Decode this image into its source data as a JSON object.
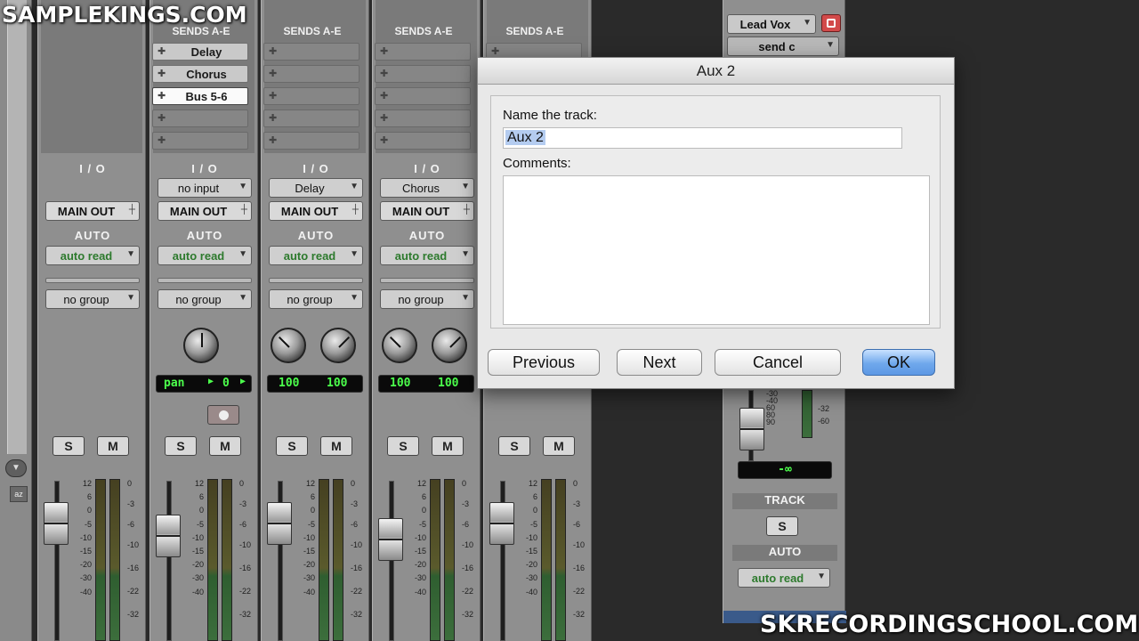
{
  "watermarks": {
    "top_left": "SAMPLEKINGS.COM",
    "bottom_right": "SKRECORDINGSCHOOL.COM"
  },
  "strips": [
    {
      "sends_title": "",
      "sends": [],
      "io_title": "I / O",
      "input": null,
      "output": "MAIN OUT",
      "auto_title": "AUTO",
      "auto_mode": "auto read",
      "group": "no group",
      "pan_type": "none",
      "lcd": null,
      "has_rec": false
    },
    {
      "sends_title": "SENDS A-E",
      "sends": [
        "Delay",
        "Chorus",
        "Bus 5-6"
      ],
      "io_title": "I / O",
      "input": "no input",
      "output": "MAIN OUT",
      "auto_title": "AUTO",
      "auto_mode": "auto read",
      "group": "no group",
      "pan_type": "mono",
      "lcd": {
        "label": "pan",
        "value": "0"
      },
      "has_rec": true
    },
    {
      "sends_title": "SENDS A-E",
      "sends": [],
      "io_title": "I / O",
      "input": "Delay",
      "output": "MAIN OUT",
      "auto_title": "AUTO",
      "auto_mode": "auto read",
      "group": "no group",
      "pan_type": "stereo",
      "lcd": {
        "left": "100",
        "right": "100"
      },
      "has_rec": false
    },
    {
      "sends_title": "SENDS A-E",
      "sends": [],
      "io_title": "I / O",
      "input": "Chorus",
      "output": "MAIN OUT",
      "auto_title": "AUTO",
      "auto_mode": "auto read",
      "group": "no group",
      "pan_type": "stereo",
      "lcd": {
        "left": "100",
        "right": "100"
      },
      "has_rec": false
    },
    {
      "sends_title": "SENDS A-E",
      "sends": [],
      "io_title": "",
      "input": null,
      "output": null,
      "auto_title": "",
      "auto_mode": null,
      "group": null,
      "pan_type": "none",
      "lcd": null,
      "has_rec": false
    }
  ],
  "solo_label": "S",
  "mute_label": "M",
  "fader_scale": [
    "12",
    "6",
    "0",
    "-5",
    "-10",
    "-15",
    "-20",
    "-30",
    "-40"
  ],
  "meter_scale": [
    "0",
    "-3",
    "-6",
    "-10",
    "-16",
    "-22",
    "-32"
  ],
  "right_strip": {
    "track_name": "Lead Vox",
    "send": "send c",
    "fader_scale": [
      "-30",
      "-40",
      "60",
      "80",
      "90"
    ],
    "meter_scale": [
      "-32",
      "-60"
    ],
    "level": "-∞",
    "track_title": "TRACK",
    "solo": "S",
    "auto_title": "AUTO",
    "auto_mode": "auto read"
  },
  "dialog": {
    "title": "Aux 2",
    "name_label": "Name the track:",
    "name_value": "Aux 2",
    "comments_label": "Comments:",
    "comments_value": "",
    "buttons": {
      "previous": "Previous",
      "next": "Next",
      "cancel": "Cancel",
      "ok": "OK"
    }
  },
  "colors": {
    "ok_button": "#6fa8ec",
    "lcd_text": "#4cff4c",
    "auto_mode_text": "#2d7a2d"
  }
}
